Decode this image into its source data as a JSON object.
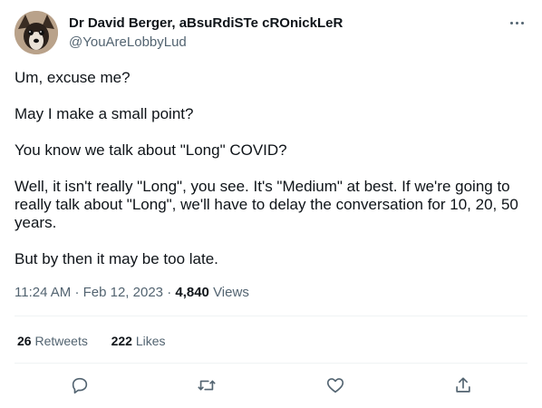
{
  "author": {
    "display_name": "Dr David Berger, aBsuRdiSTe cROnickLeR",
    "handle": "@YouAreLobbyLud"
  },
  "tweet": {
    "paragraphs": [
      "Um, excuse me?",
      "May I make a small point?",
      "You know we talk about \"Long\" COVID?",
      "Well, it isn't really \"Long\", you see. It's \"Medium\" at best. If we're going to really talk about \"Long\", we'll have to delay the conversation for 10, 20, 50 years.",
      "But by then it may be too late."
    ],
    "time": "11:24 AM",
    "separator": "·",
    "date": "Feb 12, 2023",
    "views_count": "4,840",
    "views_label": "Views"
  },
  "stats": {
    "retweets_count": "26",
    "retweets_label": "Retweets",
    "likes_count": "222",
    "likes_label": "Likes"
  },
  "icons": {
    "more": "more-horizontal-icon",
    "reply": "reply-icon",
    "retweet": "retweet-icon",
    "like": "heart-icon",
    "share": "share-icon"
  },
  "colors": {
    "text": "#0f1419",
    "secondary": "#536471",
    "divider": "#eff3f4"
  }
}
